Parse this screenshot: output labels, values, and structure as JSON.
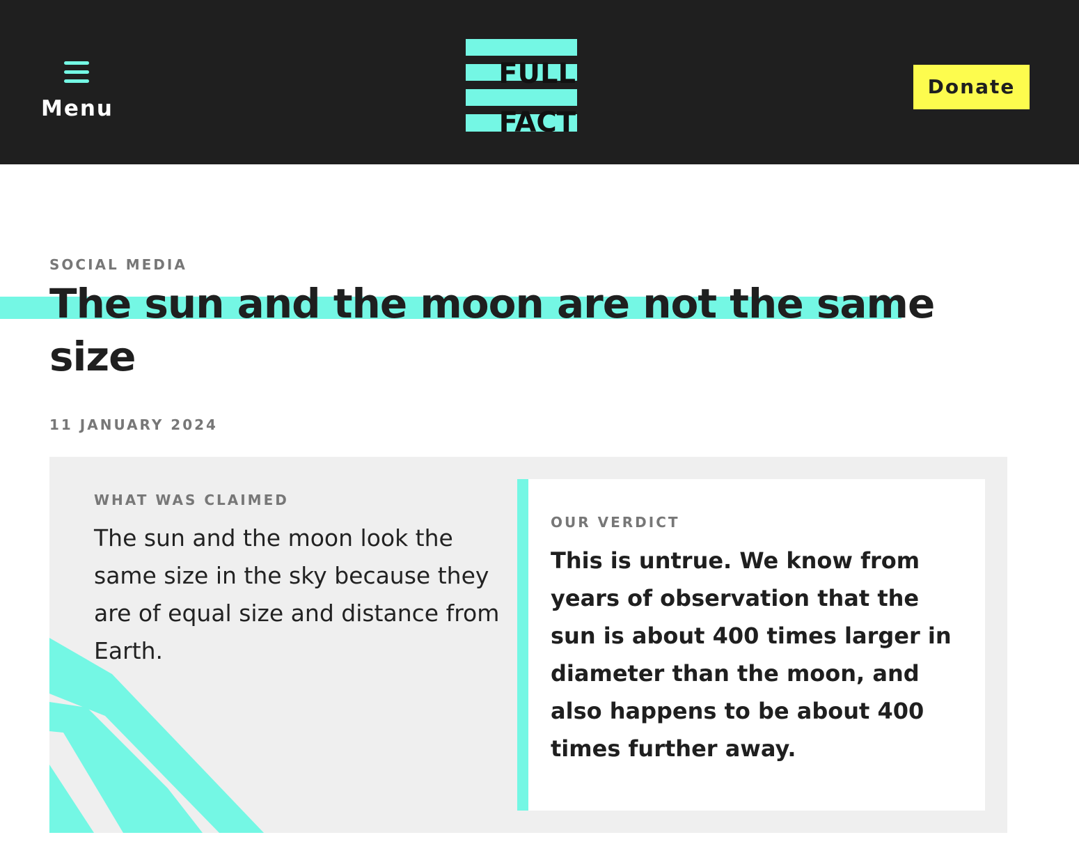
{
  "header": {
    "menu_label": "Menu",
    "logo_line1": "FULL",
    "logo_line2": "FACT",
    "donate_label": "Donate"
  },
  "article": {
    "category": "SOCIAL MEDIA",
    "title": "The sun and the moon are not the same size",
    "date": "11 JANUARY 2024"
  },
  "claim": {
    "label": "WHAT WAS CLAIMED",
    "text": "The sun and the moon look the same size in the sky because they are of equal size and distance from Earth."
  },
  "verdict": {
    "label": "OUR VERDICT",
    "text": "This is untrue. We know from years of observation that the sun is about 400 times larger in diameter than the moon, and also happens to be about 400 times further away."
  },
  "colors": {
    "header_bg": "#1f1f1f",
    "accent": "#74f7e4",
    "donate_bg": "#fdfc4e",
    "card_bg": "#efefef"
  },
  "icons": {
    "menu": "hamburger-icon"
  }
}
